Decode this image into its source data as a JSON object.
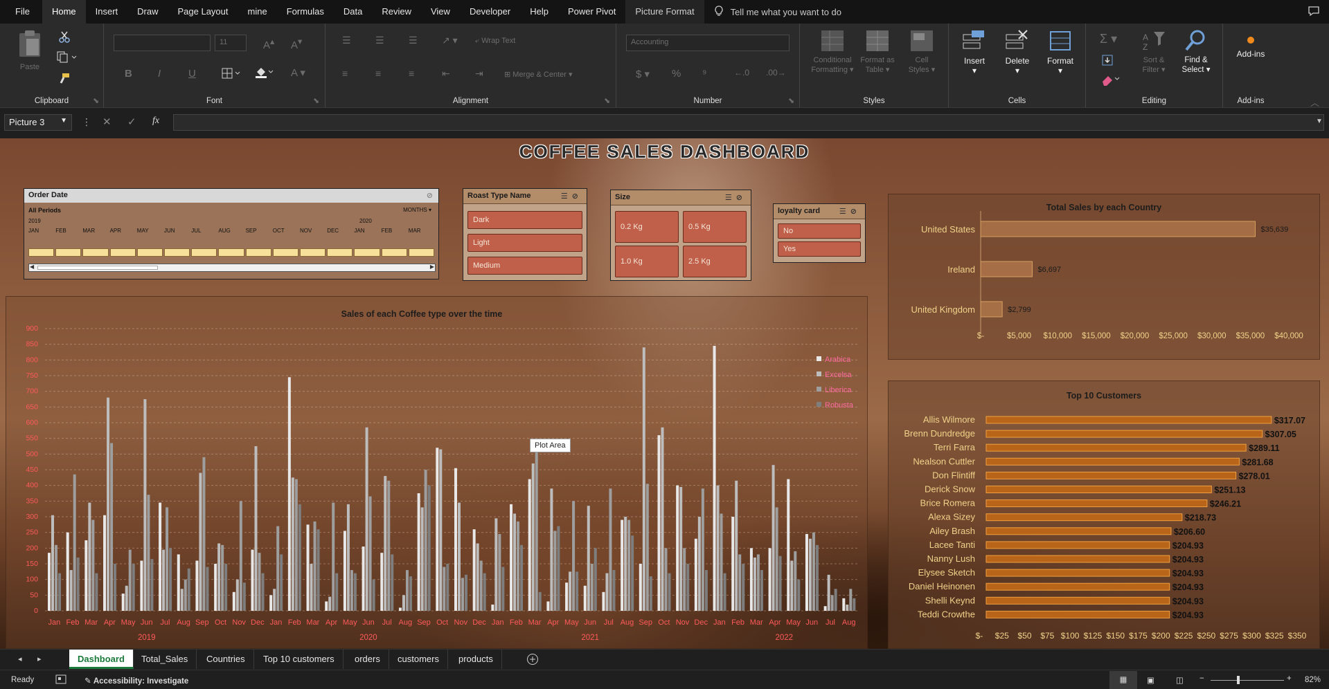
{
  "menu": {
    "tabs": [
      "File",
      "Home",
      "Insert",
      "Draw",
      "Page Layout",
      "mine",
      "Formulas",
      "Data",
      "Review",
      "View",
      "Developer",
      "Help",
      "Power Pivot",
      "Picture Format"
    ],
    "active_tab": "Home",
    "tell_me": "Tell me what you want to do"
  },
  "ribbon": {
    "clipboard": {
      "label": "Clipboard",
      "paste": "Paste"
    },
    "font": {
      "label": "Font",
      "font_size": "11"
    },
    "alignment": {
      "label": "Alignment",
      "wrap_text": "Wrap Text",
      "merge_center": "Merge & Center"
    },
    "number": {
      "label": "Number",
      "format": "Accounting",
      "currency": "$",
      "percent": "%"
    },
    "styles": {
      "label": "Styles",
      "conditional_1": "Conditional",
      "conditional_2": "Formatting",
      "format_as_1": "Format as",
      "format_as_2": "Table",
      "cell_1": "Cell",
      "cell_2": "Styles"
    },
    "cells": {
      "label": "Cells",
      "insert": "Insert",
      "delete": "Delete",
      "format": "Format"
    },
    "editing": {
      "label": "Editing",
      "sort_1": "Sort &",
      "sort_2": "Filter",
      "find_1": "Find &",
      "find_2": "Select"
    },
    "addins": {
      "label": "Add-ins",
      "button": "Add-ins"
    }
  },
  "formula_bar": {
    "name_box": "Picture 3",
    "fx": "fx",
    "content": ""
  },
  "dashboard": {
    "title": "COFFEE SALES DASHBOARD",
    "timeline": {
      "header": "Order Date",
      "periods": "All Periods",
      "level": "MONTHS",
      "year_2019": "2019",
      "year_2020": "2020",
      "months": [
        "JAN",
        "FEB",
        "MAR",
        "APR",
        "MAY",
        "JUN",
        "JUL",
        "AUG",
        "SEP",
        "OCT",
        "NOV",
        "DEC",
        "JAN",
        "FEB",
        "MAR"
      ]
    },
    "roast_slicer": {
      "header": "Roast Type Name",
      "items": [
        "Dark",
        "Light",
        "Medium"
      ]
    },
    "size_slicer": {
      "header": "Size",
      "items": [
        "0.2 Kg",
        "0.5 Kg",
        "1.0 Kg",
        "2.5 Kg"
      ]
    },
    "loyalty_slicer": {
      "header": "loyalty card",
      "items": [
        "No",
        "Yes"
      ]
    },
    "tooltip": "Plot Area"
  },
  "sheets": {
    "tabs": [
      "Dashboard",
      "Total_Sales",
      "Countries",
      "Top 10 customers",
      "orders",
      "customers",
      "products"
    ],
    "active": "Dashboard"
  },
  "status": {
    "ready": "Ready",
    "accessibility": "Accessibility: Investigate",
    "zoom": "82%"
  },
  "colors": {
    "bar_main": "#c98a55",
    "bar_border": "#6a3a10",
    "axis_label_red": "#ff5a5a",
    "slicer_button": "#c0604a"
  },
  "chart_data": [
    {
      "type": "bar",
      "title": "Sales of each Coffee type over the time",
      "ylim": [
        0,
        900
      ],
      "yticks": [
        0,
        50,
        100,
        150,
        200,
        250,
        300,
        350,
        400,
        450,
        500,
        550,
        600,
        650,
        700,
        750,
        800,
        850,
        900
      ],
      "categories": [
        "Jan",
        "Feb",
        "Mar",
        "Apr",
        "May",
        "Jun",
        "Jul",
        "Aug",
        "Sep",
        "Oct",
        "Nov",
        "Dec",
        "Jan",
        "Feb",
        "Mar",
        "Apr",
        "May",
        "Jun",
        "Jul",
        "Aug",
        "Sep",
        "Oct",
        "Nov",
        "Dec",
        "Jan",
        "Feb",
        "Mar",
        "Apr",
        "May",
        "Jun",
        "Jul",
        "Aug",
        "Sep",
        "Oct",
        "Nov",
        "Dec",
        "Jan",
        "Feb",
        "Mar",
        "Apr",
        "May",
        "Jun",
        "Jul",
        "Aug"
      ],
      "year_labels": [
        {
          "label": "2019",
          "index": 5
        },
        {
          "label": "2020",
          "index": 17
        },
        {
          "label": "2021",
          "index": 29
        },
        {
          "label": "2022",
          "index": 39.5
        }
      ],
      "series": [
        {
          "name": "Arabica",
          "color": "#e8e8e8",
          "values": [
            185,
            250,
            225,
            305,
            55,
            160,
            345,
            180,
            160,
            150,
            60,
            195,
            50,
            745,
            275,
            30,
            255,
            205,
            185,
            10,
            375,
            520,
            455,
            260,
            20,
            340,
            420,
            30,
            90,
            80,
            60,
            290,
            150,
            560,
            400,
            230,
            845,
            300,
            200,
            200,
            420,
            245,
            15,
            40
          ]
        },
        {
          "name": "Excelsa",
          "color": "#bdbdbd",
          "values": [
            305,
            130,
            345,
            680,
            80,
            675,
            195,
            70,
            440,
            215,
            100,
            525,
            70,
            425,
            150,
            45,
            340,
            585,
            430,
            50,
            330,
            515,
            345,
            215,
            295,
            310,
            470,
            390,
            125,
            335,
            120,
            300,
            840,
            585,
            395,
            300,
            400,
            415,
            170,
            465,
            160,
            230,
            115,
            20
          ]
        },
        {
          "name": "Liberica",
          "color": "#9e9e9e",
          "values": [
            210,
            435,
            290,
            535,
            195,
            370,
            330,
            100,
            490,
            210,
            350,
            185,
            270,
            420,
            285,
            345,
            130,
            365,
            415,
            130,
            450,
            140,
            105,
            160,
            245,
            285,
            550,
            255,
            350,
            150,
            390,
            290,
            405,
            200,
            200,
            390,
            310,
            180,
            180,
            330,
            190,
            250,
            50,
            70
          ]
        },
        {
          "name": "Robusta",
          "color": "#7e7e7e",
          "values": [
            120,
            170,
            120,
            150,
            150,
            165,
            200,
            135,
            140,
            150,
            90,
            120,
            180,
            340,
            260,
            120,
            120,
            100,
            180,
            110,
            400,
            150,
            115,
            120,
            140,
            210,
            60,
            270,
            125,
            200,
            130,
            240,
            110,
            120,
            150,
            130,
            120,
            150,
            130,
            175,
            100,
            210,
            70,
            40
          ]
        }
      ]
    },
    {
      "type": "bar",
      "orientation": "horizontal",
      "title": "Total Sales by each Country",
      "categories": [
        "United States",
        "Ireland",
        "United Kingdom"
      ],
      "values": [
        35639,
        6697,
        2799
      ],
      "value_labels": [
        "$35,639",
        "$6,697",
        "$2,799"
      ],
      "xlim": [
        0,
        40000
      ],
      "xticks": [
        "$-",
        "$5,000",
        "$10,000",
        "$15,000",
        "$20,000",
        "$25,000",
        "$30,000",
        "$35,000",
        "$40,000"
      ]
    },
    {
      "type": "bar",
      "orientation": "horizontal",
      "title": "Top 10 Customers",
      "categories": [
        "Allis Wilmore",
        "Brenn Dundredge",
        "Terri Farra",
        "Nealson Cuttler",
        "Don Flintiff",
        "Derick Snow",
        "Brice Romera",
        "Alexa Sizey",
        "Ailey Brash",
        "Lacee Tanti",
        "Nanny Lush",
        "Elysee Sketch",
        "Daniel Heinonen",
        "Shelli Keynd",
        "Teddi Crowthe"
      ],
      "values": [
        317.07,
        307.05,
        289.11,
        281.68,
        278.01,
        251.13,
        246.21,
        218.73,
        206.6,
        204.93,
        204.93,
        204.93,
        204.93,
        204.93,
        204.93
      ],
      "value_labels": [
        "$317.07",
        "$307.05",
        "$289.11",
        "$281.68",
        "$278.01",
        "$251.13",
        "$246.21",
        "$218.73",
        "$206.60",
        "$204.93",
        "$204.93",
        "$204.93",
        "$204.93",
        "$204.93",
        "$204.93"
      ],
      "xlim": [
        0,
        350
      ],
      "xticks": [
        "$-",
        "$25",
        "$50",
        "$75",
        "$100",
        "$125",
        "$150",
        "$175",
        "$200",
        "$225",
        "$250",
        "$275",
        "$300",
        "$325",
        "$350"
      ]
    }
  ]
}
